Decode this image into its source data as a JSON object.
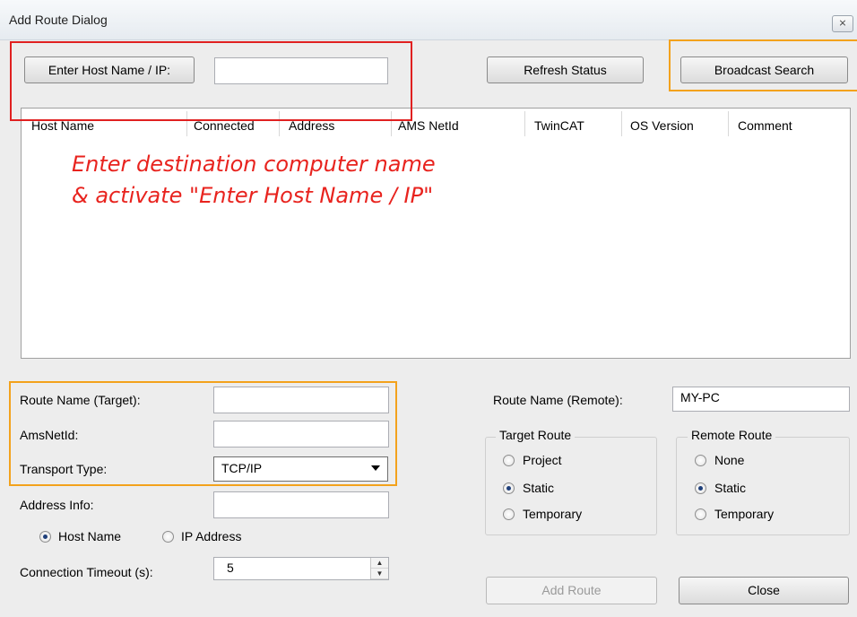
{
  "window": {
    "title": "Add Route Dialog",
    "close_glyph": "⨯"
  },
  "top": {
    "enter_host_button": "Enter Host Name / IP:",
    "host_input_value": "",
    "refresh_button": "Refresh Status",
    "broadcast_button": "Broadcast Search"
  },
  "table": {
    "columns": [
      "Host Name",
      "Connected",
      "Address",
      "AMS NetId",
      "TwinCAT",
      "OS Version",
      "Comment"
    ]
  },
  "annotation": {
    "line1": "Enter destination computer name",
    "line2": "& activate \"Enter Host Name / IP\""
  },
  "form": {
    "route_name_target_label": "Route Name (Target):",
    "route_name_target_value": "",
    "amsnetid_label": "AmsNetId:",
    "amsnetid_value": "",
    "transport_type_label": "Transport Type:",
    "transport_type_value": "TCP/IP",
    "address_info_label": "Address Info:",
    "address_info_value": "",
    "host_name_radio": "Host Name",
    "ip_address_radio": "IP Address",
    "address_mode_selected": "Host Name",
    "timeout_label": "Connection Timeout (s):",
    "timeout_value": "5"
  },
  "remote": {
    "route_name_remote_label": "Route Name (Remote):",
    "route_name_remote_value": "MY-PC",
    "target_route_title": "Target Route",
    "target_route_options": [
      "Project",
      "Static",
      "Temporary"
    ],
    "target_route_selected": "Static",
    "remote_route_title": "Remote Route",
    "remote_route_options": [
      "None",
      "Static",
      "Temporary"
    ],
    "remote_route_selected": "Static"
  },
  "footer": {
    "add_route_button": "Add Route",
    "close_button": "Close"
  },
  "colors": {
    "highlight_red": "#e02020",
    "highlight_orange": "#f3a21c",
    "annotation": "#e8231e"
  }
}
